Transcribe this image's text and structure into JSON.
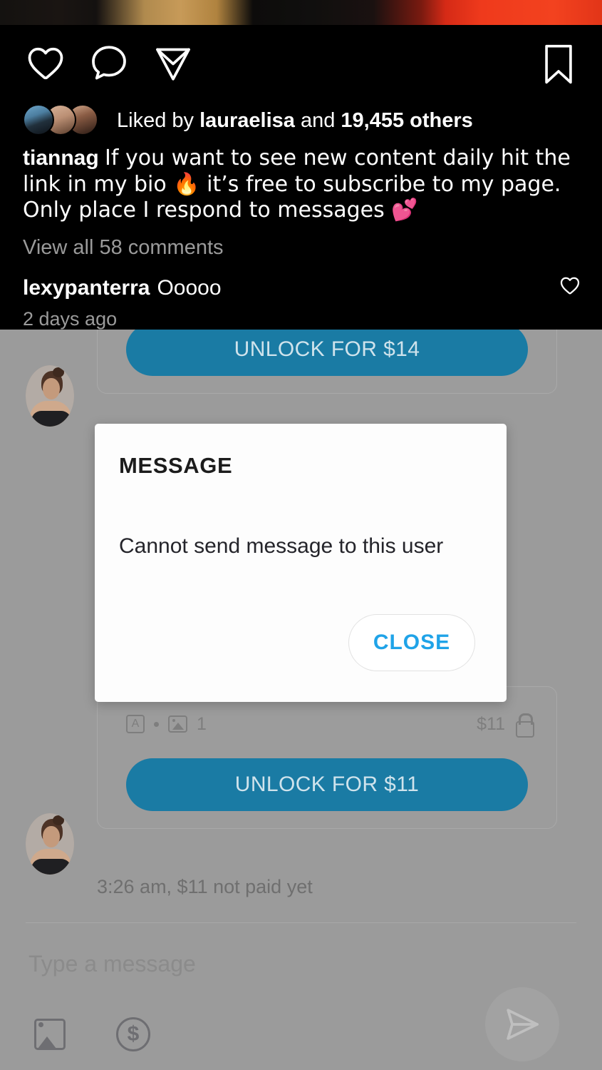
{
  "instagram_overlay": {
    "actions": [
      {
        "name": "like",
        "icon": "heart-icon"
      },
      {
        "name": "comment",
        "icon": "comment-bubble-icon"
      },
      {
        "name": "share",
        "icon": "share-paper-plane-icon"
      },
      {
        "name": "save",
        "icon": "bookmark-icon"
      }
    ],
    "likes": {
      "prefix": "Liked by ",
      "username": "lauraelisa",
      "middle": " and ",
      "count": "19,455",
      "suffix": " others",
      "avatar_count": 3
    },
    "caption": {
      "username": "tiannag",
      "text": "If you want to see new content daily hit the link in my bio 🔥 it’s free to subscribe to my page. Only place I respond to messages 💕"
    },
    "view_all_comments": "View all 58 comments",
    "comment": {
      "username": "lexypanterra",
      "text": "Ooooo",
      "like_icon": "heart-outline-icon"
    },
    "timestamp": "2 days ago"
  },
  "messenger": {
    "top_bubble": {
      "unlock_label": "UNLOCK FOR $14"
    },
    "bottom_bubble": {
      "meta_text_icon": "text-glyph-icon",
      "meta_media_icon": "image-icon",
      "media_count": "1",
      "price": "$11",
      "lock_icon": "lock-icon",
      "unlock_label": "UNLOCK FOR $11"
    },
    "thread_timestamp": "3:26 am, $11 not paid yet",
    "composer": {
      "placeholder": "Type a message",
      "value": "",
      "photo_icon": "image-icon",
      "tip_icon": "dollar-circle-icon",
      "send_icon": "send-paper-plane-icon"
    }
  },
  "modal": {
    "title": "MESSAGE",
    "body": "Cannot send message to this user",
    "close_label": "CLOSE"
  },
  "colors": {
    "unlock_blue": "#1a7ba4",
    "close_blue": "#1fa3e8",
    "dim_background": "#9b9b9b",
    "overlay_black": "#000000"
  }
}
